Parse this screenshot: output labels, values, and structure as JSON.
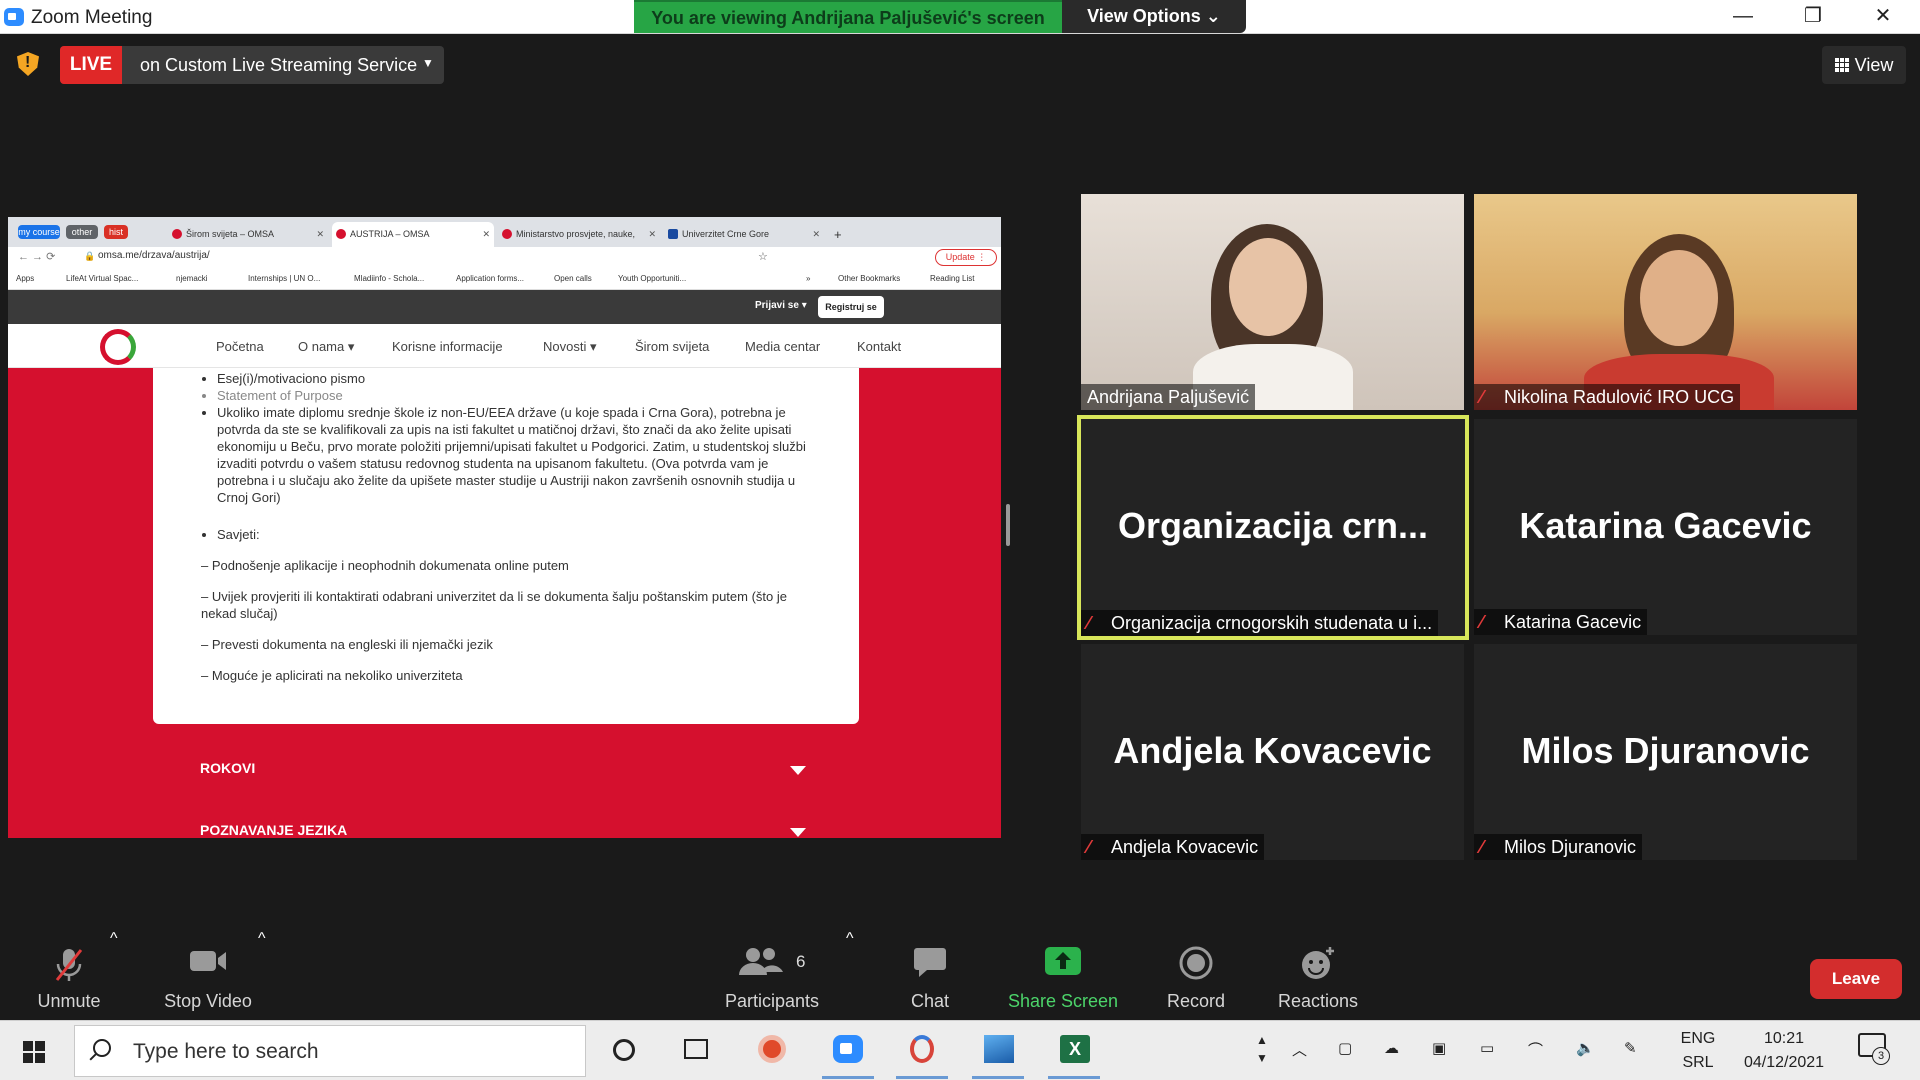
{
  "window": {
    "app_title": "Zoom Meeting",
    "viewing_banner": "You are viewing Andrijana Paljušević's screen",
    "view_options": "View Options ⌄",
    "minimize": "—",
    "restore": "❐",
    "close": "✕"
  },
  "meeting_bar": {
    "live_badge": "LIVE",
    "live_text": "on Custom Live Streaming Service",
    "live_caret": "▼",
    "view_button": "View"
  },
  "shared_screen": {
    "chips": [
      {
        "label": "my course",
        "color": "#1a73e8"
      },
      {
        "label": "other",
        "color": "#5f6368"
      },
      {
        "label": "hist",
        "color": "#d93025"
      }
    ],
    "tabs": [
      {
        "label": "Širom svijeta – OMSA",
        "active": false
      },
      {
        "label": "AUSTRIJA – OMSA",
        "active": true
      },
      {
        "label": "Ministarstvo prosvjete, nauke,",
        "active": false
      },
      {
        "label": "Univerzitet Crne Gore",
        "active": false
      }
    ],
    "new_tab": "+",
    "url": "omsa.me/drzava/austrija/",
    "update_button": "Update ⋮",
    "bookmarks": [
      "Apps",
      "LifeAt Virtual Spac...",
      "njemacki",
      "Internships | UN O...",
      "Mladiinfo - Schola...",
      "Application forms...",
      "Open calls",
      "Youth Opportuniti...",
      "»",
      "Other Bookmarks",
      "Reading List"
    ],
    "site": {
      "login": "Prijavi se ▾",
      "register": "Registruj se",
      "nav": [
        "Početna",
        "O nama ▾",
        "Korisne informacije",
        "Novosti ▾",
        "Širom svijeta",
        "Media centar",
        "Kontakt"
      ],
      "list_items": [
        "Esej(i)/motivaciono pismo",
        "Statement of Purpose"
      ],
      "long_item": "Ukoliko imate diplomu srednje škole iz non-EU/EEA države (u koje spada i Crna Gora), potrebna je potvrda da ste se kvalifikovali za upis na isti fakultet u matičnoj državi, što znači da ako želite upisati ekonomiju u Beču, prvo morate položiti prijemni/upisati fakultet u Podgorici. Zatim, u studentskoj službi izvaditi potvrdu o vašem statusu redovnog studenta na upisanom fakultetu. (Ova potvrda vam je potrebna i u slučaju ako želite da upišete master studije u Austriji nakon završenih osnovnih studija u Crnoj Gori)",
      "tips_heading": "Savjeti:",
      "tips": [
        "– Podnošenje aplikacije i neophodnih dokumenata online putem",
        "– Uvijek provjeriti ili kontaktirati odabrani univerzitet da li se dokumenta šalju poštanskim putem (što je nekad slučaj)",
        "– Prevesti dokumenta na engleski ili njemački jezik",
        "– Moguće je aplicirati na nekoliko univerziteta"
      ],
      "accordion": [
        "ROKOVI",
        "POZNAVANJE JEZIKA"
      ]
    }
  },
  "participants": [
    {
      "name": "Andrijana Paljušević",
      "label": "Andrijana Paljušević",
      "video": true,
      "muted": false
    },
    {
      "name": "Nikolina Radulović IRO UCG",
      "label": "Nikolina Radulović IRO UCG",
      "video": true,
      "muted": true
    },
    {
      "big": "Organizacija  crn...",
      "label": "Organizacija crnogorskih studenata u i...",
      "video": false,
      "muted": true,
      "active": true
    },
    {
      "big": "Katarina Gacevic",
      "label": "Katarina Gacevic",
      "video": false,
      "muted": true
    },
    {
      "big": "Andjela Kovacevic",
      "label": "Andjela Kovacevic",
      "video": false,
      "muted": true
    },
    {
      "big": "Milos Djuranovic",
      "label": "Milos Djuranovic",
      "video": false,
      "muted": true
    }
  ],
  "toolbar": {
    "unmute": "Unmute",
    "stop_video": "Stop Video",
    "participants": "Participants",
    "participants_count": "6",
    "chat": "Chat",
    "share_screen": "Share Screen",
    "record": "Record",
    "reactions": "Reactions",
    "leave": "Leave",
    "caret": "^"
  },
  "taskbar": {
    "search_placeholder": "Type here to search",
    "lang_top": "ENG",
    "lang_bottom": "SRL",
    "time": "10:21",
    "date": "04/12/2021",
    "notification_count": "3"
  },
  "colors": {
    "zoom_green": "#27a545",
    "live_red": "#e02828",
    "active_speaker": "#d8e65a",
    "omsa_red": "#d5102e"
  }
}
